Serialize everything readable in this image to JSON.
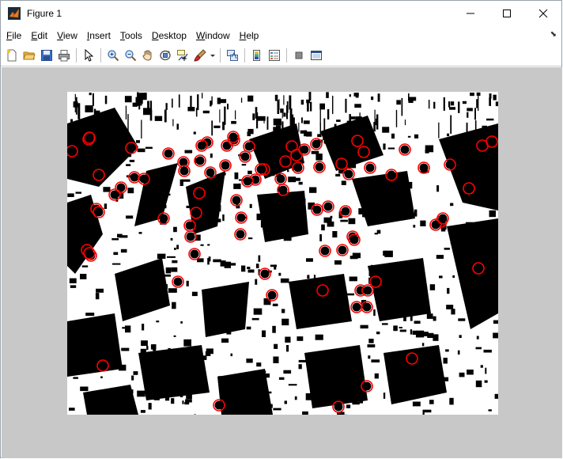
{
  "window": {
    "title": "Figure 1",
    "controls": {
      "minimize": "—",
      "maximize": "☐",
      "close": "✕"
    }
  },
  "menu": {
    "items": [
      {
        "label": "File",
        "accel": "F"
      },
      {
        "label": "Edit",
        "accel": "E"
      },
      {
        "label": "View",
        "accel": "V"
      },
      {
        "label": "Insert",
        "accel": "I"
      },
      {
        "label": "Tools",
        "accel": "T"
      },
      {
        "label": "Desktop",
        "accel": "D"
      },
      {
        "label": "Window",
        "accel": "W"
      },
      {
        "label": "Help",
        "accel": "H"
      }
    ]
  },
  "toolbar": {
    "icons": [
      "new-figure-icon",
      "open-file-icon",
      "save-icon",
      "print-icon",
      "pointer-icon",
      "zoom-in-icon",
      "zoom-out-icon",
      "pan-hand-icon",
      "rotate-3d-icon",
      "data-cursor-icon",
      "brush-icon",
      "brush-dropdown-icon",
      "link-plot-icon",
      "insert-colorbar-icon",
      "insert-legend-icon",
      "hide-plot-tools-icon",
      "show-plot-tools-icon"
    ]
  },
  "figure": {
    "background": "#c8c8c8",
    "image_colors": {
      "foreground": "#000000",
      "background": "#ffffff",
      "circle": "#ff0000"
    },
    "detected_circles_count": 86
  }
}
